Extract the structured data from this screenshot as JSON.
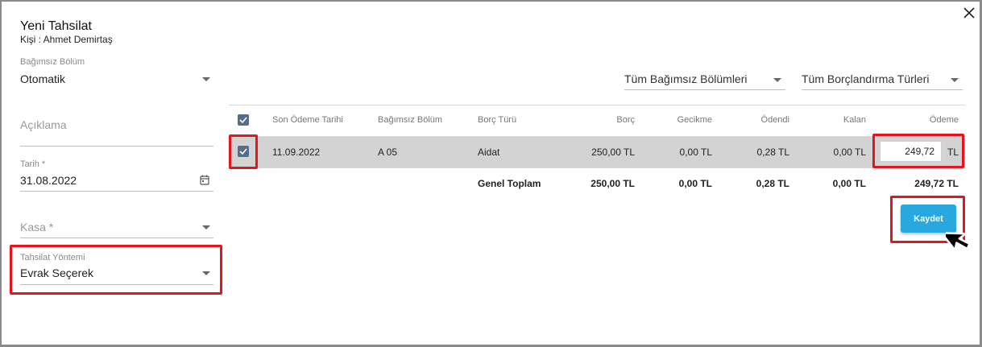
{
  "dialog": {
    "title": "Yeni Tahsilat",
    "person": "Kişi : Ahmet Demirtaş",
    "close_icon": "close-icon"
  },
  "form": {
    "unit_label": "Bağımsız Bölüm",
    "unit_value": "Otomatik",
    "description_placeholder": "Açıklama",
    "date_label": "Tarih *",
    "date_value": "31.08.2022",
    "cash_placeholder": "Kasa *",
    "method_label": "Tahsilat Yöntemi",
    "method_value": "Evrak Seçerek"
  },
  "filters": {
    "units": "Tüm Bağımsız Bölümleri",
    "debt_types": "Tüm Borçlandırma Türleri"
  },
  "table": {
    "headers": [
      "Son Ödeme Tarihi",
      "Bağımsız Bölüm",
      "Borç Türü",
      "Borç",
      "Gecikme",
      "Ödendi",
      "Kalan",
      "Ödeme"
    ],
    "rows": [
      {
        "checked": true,
        "due_date": "11.09.2022",
        "unit": "A 05",
        "type": "Aidat",
        "debt": "250,00 TL",
        "delay": "0,00 TL",
        "paid": "0,28 TL",
        "remaining": "0,00 TL",
        "payment": "249,72",
        "payment_currency": "TL"
      }
    ],
    "totals": {
      "label": "Genel Toplam",
      "debt": "250,00 TL",
      "delay": "0,00 TL",
      "paid": "0,28 TL",
      "remaining": "0,00 TL",
      "payment": "249,72 TL"
    }
  },
  "actions": {
    "save_label": "Kaydet"
  },
  "colors": {
    "accent": "#29a8e0",
    "highlight": "#e8141b",
    "checkbox": "#546e8a",
    "row_selected": "#d3d3d3"
  }
}
